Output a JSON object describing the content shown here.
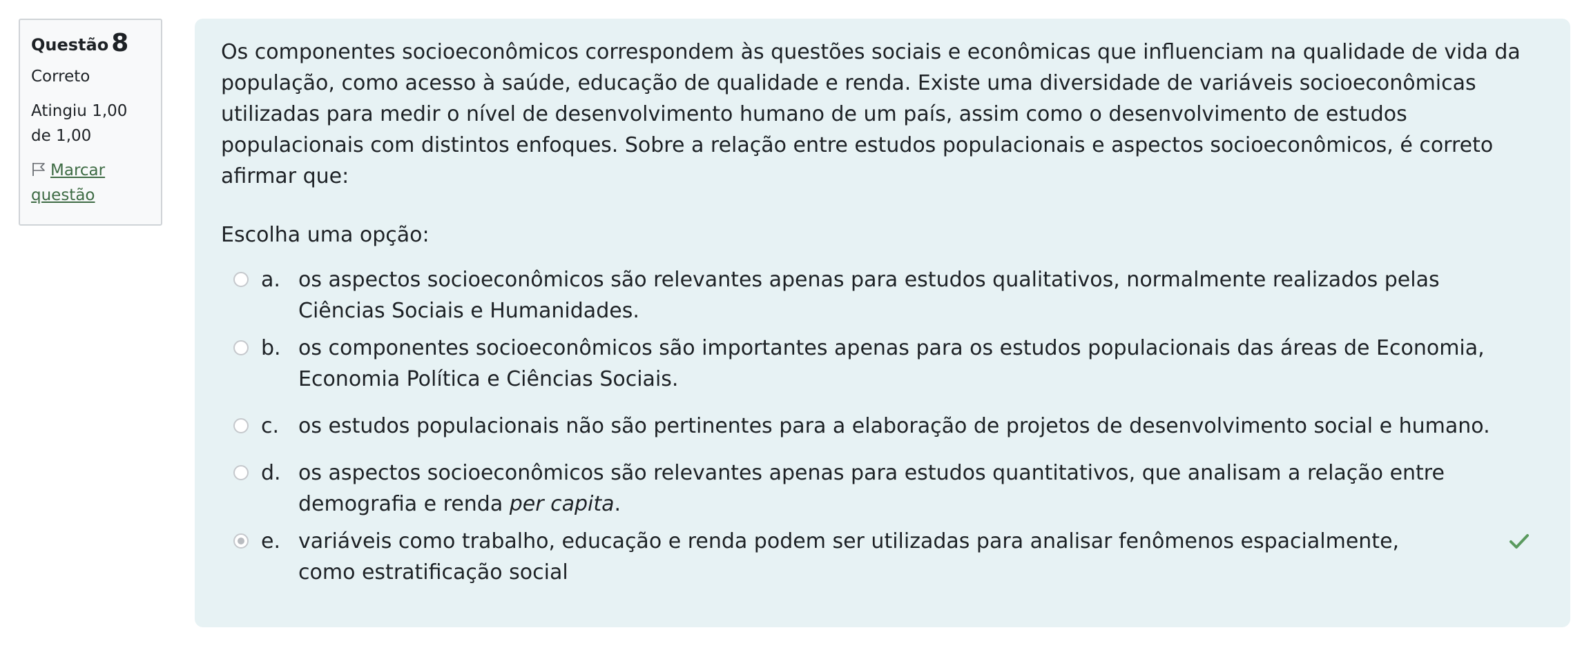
{
  "info": {
    "title_prefix": "Questão",
    "number": "8",
    "state": "Correto",
    "grade": "Atingiu 1,00 de 1,00",
    "flag_label": "Marcar questão"
  },
  "question": {
    "text": "Os componentes socioeconômicos correspondem às questões sociais e econômicas que influenciam na qualidade de vida da população, como acesso à saúde, educação de qualidade e renda. Existe uma diversidade de variáveis socioeconômicas utilizadas para medir o nível de desenvolvimento humano de um país, assim como o desenvolvimento de estudos populacionais com distintos enfoques. Sobre a relação entre estudos populacionais e aspectos socioeconômicos, é correto afirmar que:",
    "prompt": "Escolha uma opção:"
  },
  "answers": [
    {
      "letter": "a.",
      "text": "os aspectos socioeconômicos são relevantes apenas para estudos qualitativos, normalmente realizados pelas Ciências Sociais e Humanidades.",
      "selected": false
    },
    {
      "letter": "b.",
      "text": "os componentes socioeconômicos são importantes apenas para os estudos populacionais das áreas de Economia, Economia Política e Ciências Sociais.",
      "selected": false
    },
    {
      "letter": "c.",
      "text": "os estudos populacionais não são pertinentes para a elaboração de projetos de desenvolvimento social e humano.",
      "selected": false
    },
    {
      "letter": "d.",
      "text_before": "os aspectos socioeconômicos são relevantes apenas para estudos quantitativos, que analisam a relação entre demografia e renda ",
      "text_italic": "per capita",
      "text_after": ".",
      "selected": false
    },
    {
      "letter": "e.",
      "text": "variáveis como trabalho, educação e renda podem ser utilizadas para analisar fenômenos espacialmente, como estratificação social",
      "selected": true,
      "correct_icon": "check-icon"
    }
  ],
  "colors": {
    "content_bg": "#e7f2f4",
    "info_bg": "#f8f9fa",
    "link": "#3e6b44",
    "check": "#5a9a5e"
  }
}
